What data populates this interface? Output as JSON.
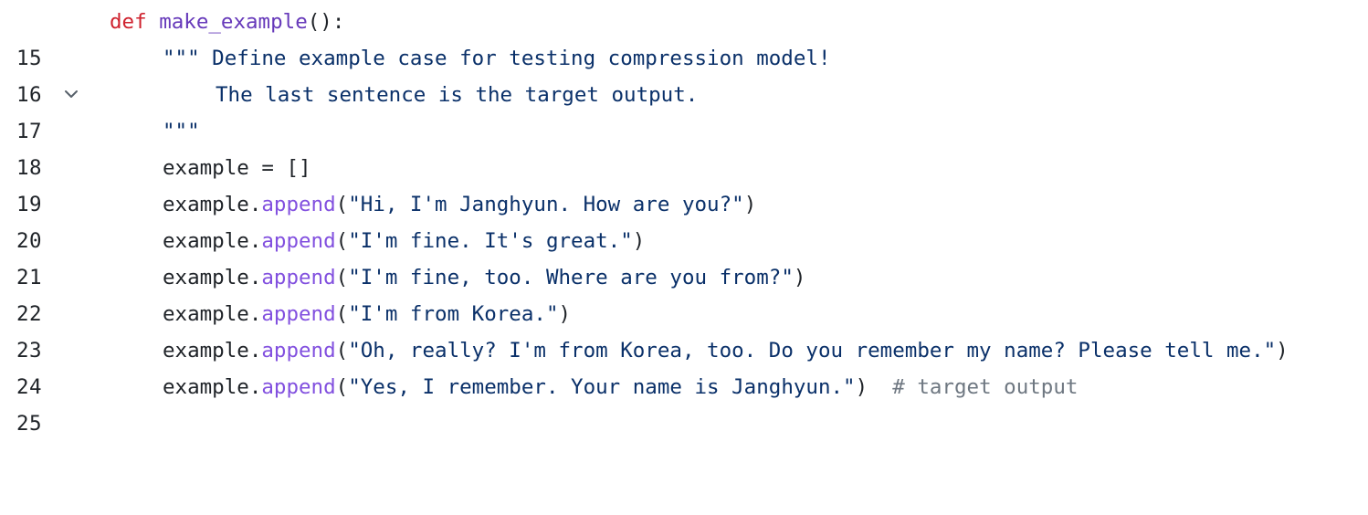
{
  "editor": {
    "lines": [
      {
        "no": "15",
        "parts": {
          "kw": "def",
          "sp": " ",
          "fn": "make_example",
          "rest": "():"
        }
      },
      {
        "no": "16",
        "doc": "\"\"\" Define example case for testing compression model!"
      },
      {
        "no": "17",
        "doc": "The last sentence is the target output."
      },
      {
        "no": "18",
        "doc": "\"\"\""
      },
      {
        "no": "19",
        "plain": "example = []"
      },
      {
        "no": "20",
        "call": {
          "obj": "example.",
          "method": "append",
          "open": "(",
          "arg": "\"Hi, I'm Janghyun. How are you?\"",
          "close": ")"
        }
      },
      {
        "no": "21",
        "call": {
          "obj": "example.",
          "method": "append",
          "open": "(",
          "arg": "\"I'm fine. It's great.\"",
          "close": ")"
        }
      },
      {
        "no": "22",
        "call": {
          "obj": "example.",
          "method": "append",
          "open": "(",
          "arg": "\"I'm fine, too. Where are you from?\"",
          "close": ")"
        }
      },
      {
        "no": "23",
        "call": {
          "obj": "example.",
          "method": "append",
          "open": "(",
          "arg": "\"I'm from Korea.\"",
          "close": ")"
        }
      },
      {
        "no": "24",
        "call": {
          "obj": "example.",
          "method": "append",
          "open": "(",
          "arg": "\"Oh, really? I'm from Korea, too. Do you remember my name? Please tell me.\"",
          "close": ")"
        }
      },
      {
        "no": "25",
        "call": {
          "obj": "example.",
          "method": "append",
          "open": "(",
          "arg": "\"Yes, I remember. Your name is Janghyun.\"",
          "close": ")",
          "comment": "  # target output"
        }
      }
    ]
  },
  "icons": {
    "fold": "chevron-down-icon"
  },
  "colors": {
    "keyword": "#cf222e",
    "function_name": "#6639ba",
    "method": "#8250df",
    "string": "#0a3069",
    "text": "#1f2328",
    "comment": "#6e7781"
  }
}
